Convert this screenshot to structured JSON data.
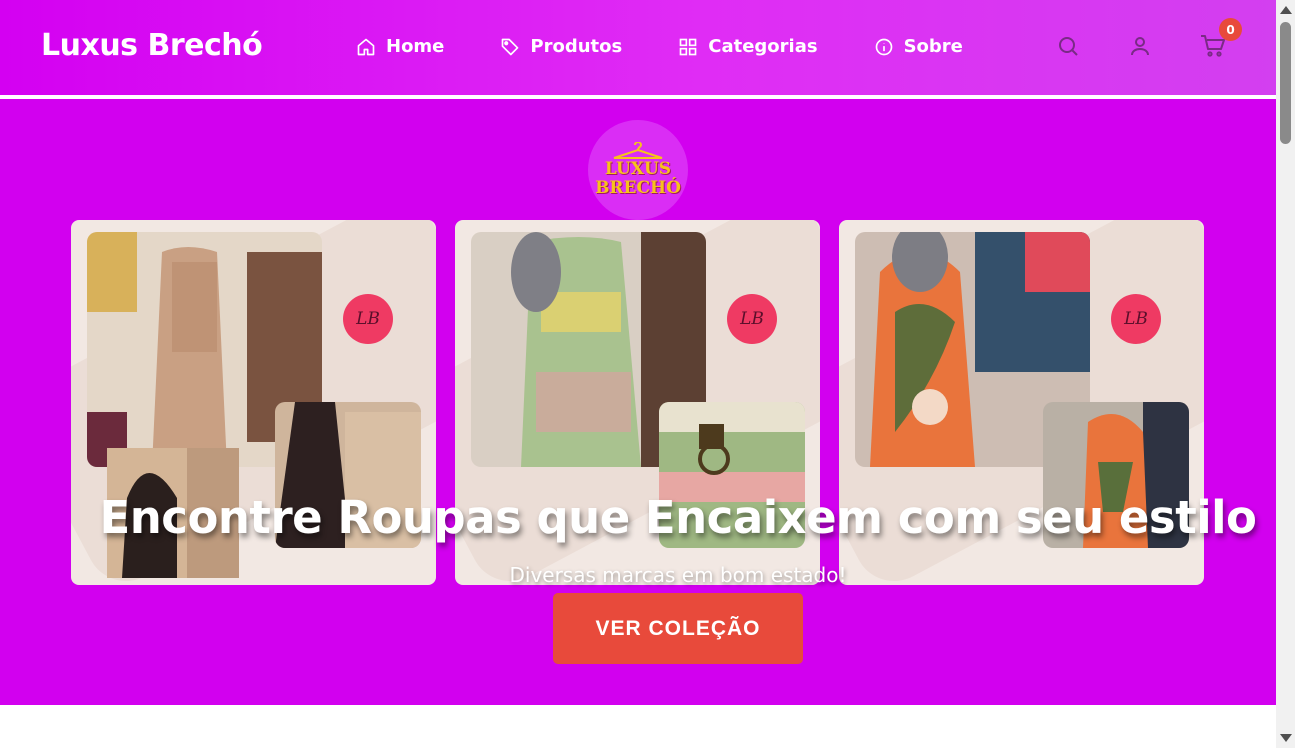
{
  "header": {
    "brand": "Luxus Brechó",
    "nav": [
      {
        "label": "Home",
        "icon": "home-icon"
      },
      {
        "label": "Produtos",
        "icon": "tag-icon"
      },
      {
        "label": "Categorias",
        "icon": "grid-icon"
      },
      {
        "label": "Sobre",
        "icon": "info-icon"
      }
    ],
    "cart_count": "0"
  },
  "hero": {
    "logo_line1": "LUXUS",
    "logo_line2": "BRECHÓ",
    "card_badge": "LB",
    "title": "Encontre Roupas que Encaixem com seu estilo",
    "subtitle": "Diversas marcas em bom estado!",
    "cta_label": "VER COLEÇÃO"
  },
  "colors": {
    "header_bg": "#d400f2",
    "hero_bg": "#d200ef",
    "accent": "#e84a3b",
    "logo_text": "#f6c21c"
  }
}
